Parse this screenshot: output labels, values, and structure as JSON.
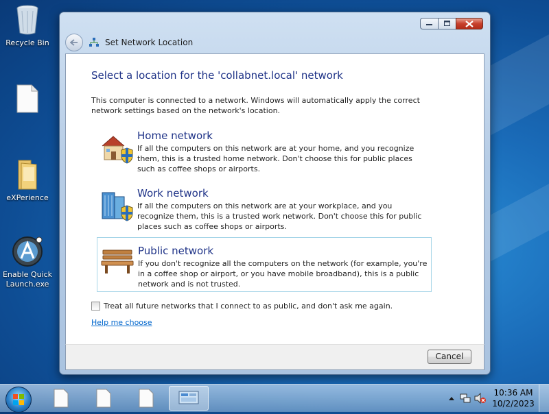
{
  "desktop": {
    "icons": [
      {
        "label": "Recycle Bin",
        "icon": "recycle-bin-icon"
      },
      {
        "label": "",
        "icon": "blank-file-icon"
      },
      {
        "label": "eXPerience",
        "icon": "folder-icon"
      },
      {
        "label": "Enable Quick Launch.exe",
        "label_line1": "Enable Quick",
        "label_line2": "Launch.exe",
        "icon": "quick-launch-app-icon"
      }
    ]
  },
  "window": {
    "nav_title": "Set Network Location",
    "heading": "Select a location for the 'collabnet.local' network",
    "intro": "This computer is connected to a network. Windows will automatically apply the correct network settings based on the network's location.",
    "options": [
      {
        "title": "Home network",
        "description": "If all the computers on this network are at your home, and you recognize them, this is a trusted home network.  Don't choose this for public places such as coffee shops or airports.",
        "icon": "home-network-icon"
      },
      {
        "title": "Work network",
        "description": "If all the computers on this network are at your workplace, and you recognize them, this is a trusted work network.  Don't choose this for public places such as coffee shops or airports.",
        "icon": "work-network-icon"
      },
      {
        "title": "Public network",
        "description": "If you don't recognize all the computers on the network (for example, you're in a coffee shop or airport, or you have mobile broadband), this is a public network and is not trusted.",
        "icon": "public-network-icon",
        "highlighted": true
      }
    ],
    "checkbox_label": "Treat all future networks that I connect to as public, and don't ask me again.",
    "checkbox_checked": false,
    "help_link": "Help me choose",
    "cancel_label": "Cancel"
  },
  "taskbar": {
    "clock_time": "10:36 AM",
    "clock_date": "10/2/2023"
  },
  "colors": {
    "heading_blue": "#1e3287",
    "link_blue": "#0066cc",
    "close_red": "#c8402c"
  }
}
